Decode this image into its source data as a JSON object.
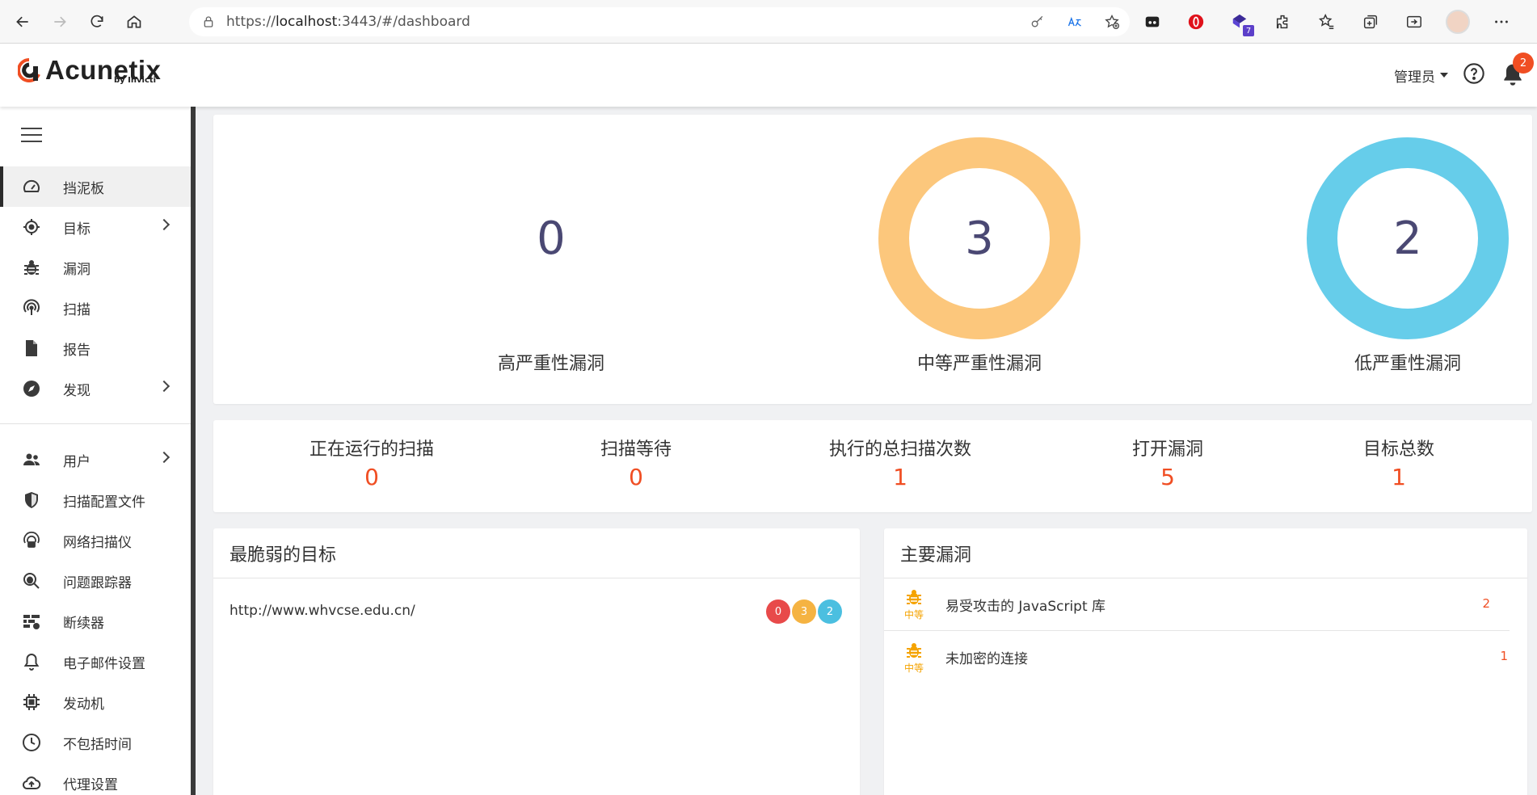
{
  "browser": {
    "url_prefix": "https://",
    "url_host": "localhost",
    "url_rest": ":3443/#/dashboard",
    "ext_badge": "7"
  },
  "header": {
    "logo_text": "Acunetix",
    "logo_sub": "by Invicti",
    "user_label": "管理员",
    "notification_count": "2"
  },
  "sidebar": {
    "items": [
      {
        "label": "挡泥板"
      },
      {
        "label": "目标"
      },
      {
        "label": "漏洞"
      },
      {
        "label": "扫描"
      },
      {
        "label": "报告"
      },
      {
        "label": "发现"
      },
      {
        "label": "用户"
      },
      {
        "label": "扫描配置文件"
      },
      {
        "label": "网络扫描仪"
      },
      {
        "label": "问题跟踪器"
      },
      {
        "label": "断续器"
      },
      {
        "label": "电子邮件设置"
      },
      {
        "label": "发动机"
      },
      {
        "label": "不包括时间"
      },
      {
        "label": "代理设置"
      }
    ]
  },
  "severity": {
    "high": {
      "count": "0",
      "label": "高严重性漏洞",
      "color": "#f04e4e"
    },
    "medium": {
      "count": "3",
      "label": "中等严重性漏洞",
      "color": "#fcc77c"
    },
    "low": {
      "count": "2",
      "label": "低严重性漏洞",
      "color": "#66cdea"
    }
  },
  "stats": {
    "running": {
      "label": "正在运行的扫描",
      "value": "0"
    },
    "waiting": {
      "label": "扫描等待",
      "value": "0"
    },
    "total": {
      "label": "执行的总扫描次数",
      "value": "1"
    },
    "open": {
      "label": "打开漏洞",
      "value": "5"
    },
    "targets": {
      "label": "目标总数",
      "value": "1"
    }
  },
  "vulnerable_targets": {
    "title": "最脆弱的目标",
    "rows": [
      {
        "url": "http://www.whvcse.edu.cn/",
        "high": "0",
        "medium": "3",
        "low": "2"
      }
    ]
  },
  "top_vulns": {
    "title": "主要漏洞",
    "rows": [
      {
        "severity": "中等",
        "name": "易受攻击的 JavaScript 库",
        "count": "2"
      },
      {
        "severity": "中等",
        "name": "未加密的连接",
        "count": "1"
      }
    ]
  },
  "colors": {
    "accent": "#f04e23",
    "high": "#e84a4a",
    "medium": "#f5b342",
    "low": "#4bbfe0",
    "number": "#4a4873"
  }
}
